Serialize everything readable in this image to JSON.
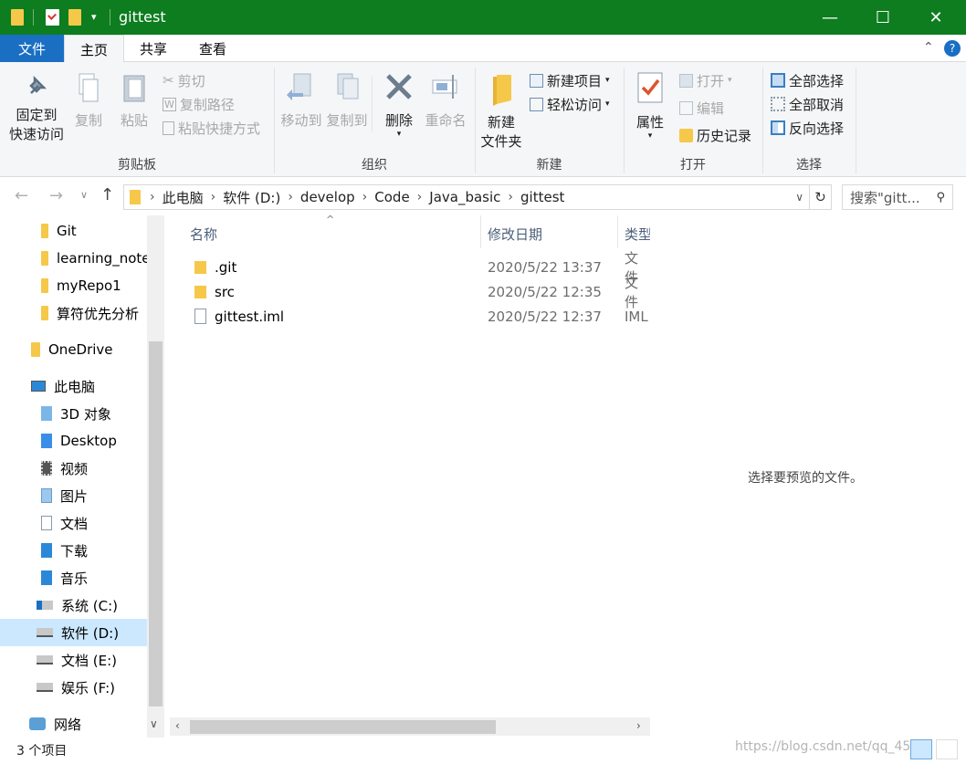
{
  "window": {
    "title": "gittest",
    "controls": {
      "minimize": "—",
      "maximize": "☐",
      "close": "✕"
    }
  },
  "ribbon_tabs": [
    "文件",
    "主页",
    "共享",
    "查看"
  ],
  "ribbon": {
    "clipboard": {
      "label": "剪贴板",
      "pin": [
        "固定到",
        "快速访问"
      ],
      "copy": "复制",
      "paste": "粘贴",
      "cut": "剪切",
      "copy_path": "复制路径",
      "paste_shortcut": "粘贴快捷方式"
    },
    "organize": {
      "label": "组织",
      "move_to": "移动到",
      "copy_to": "复制到",
      "delete": "删除",
      "rename": "重命名"
    },
    "new": {
      "label": "新建",
      "new_folder": [
        "新建",
        "文件夹"
      ],
      "new_item": "新建项目",
      "easy_access": "轻松访问"
    },
    "open": {
      "label": "打开",
      "properties": "属性",
      "open": "打开",
      "edit": "编辑",
      "history": "历史记录"
    },
    "select": {
      "label": "选择",
      "select_all": "全部选择",
      "select_none": "全部取消",
      "invert": "反向选择"
    }
  },
  "address": {
    "crumbs": [
      "此电脑",
      "软件 (D:)",
      "develop",
      "Code",
      "Java_basic",
      "gittest"
    ],
    "search_placeholder": "搜索\"gitt..."
  },
  "nav": {
    "quick": [
      "Git",
      "learning_notes",
      "myRepo1",
      "算符优先分析"
    ],
    "onedrive": "OneDrive",
    "this_pc": "此电脑",
    "pc_items": [
      "3D 对象",
      "Desktop",
      "视频",
      "图片",
      "文档",
      "下载",
      "音乐",
      "系统 (C:)",
      "软件 (D:)",
      "文档 (E:)",
      "娱乐 (F:)"
    ],
    "network": "网络"
  },
  "columns": {
    "name": "名称",
    "date": "修改日期",
    "type": "类型"
  },
  "files": [
    {
      "name": ".git",
      "date": "2020/5/22 13:37",
      "type": "文件"
    },
    {
      "name": "src",
      "date": "2020/5/22 12:35",
      "type": "文件"
    },
    {
      "name": "gittest.iml",
      "date": "2020/5/22 12:37",
      "type": "IML"
    }
  ],
  "preview": {
    "message": "选择要预览的文件。"
  },
  "status": {
    "count": "3 个项目",
    "watermark": "https://blog.csdn.net/qq_45"
  },
  "colors": {
    "titlebar": "#0d7d1f",
    "accent": "#1a6fc3",
    "folder": "#f6c84a",
    "selected": "#cce8ff"
  }
}
